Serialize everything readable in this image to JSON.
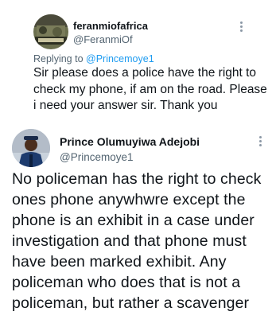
{
  "reply_tweet": {
    "display_name": "feranmiofafrica",
    "handle": "@FeranmiOf",
    "replying_to_prefix": "Replying to ",
    "replying_to_mention": "@Princemoye1",
    "body": "Sir please does a police have the right to check my phone, if am on the road. Please i need your answer sir. Thank you",
    "avatar_icon": "military-avatar-icon"
  },
  "main_tweet": {
    "display_name": "Prince Olumuyiwa Adejobi",
    "handle": "@Princemoye1",
    "body": "No policeman has the right to check ones phone anywhwre except the phone is an exhibit in a case under investigation and that phone must have been marked exhibit. Any policeman who does that is not a policeman, but rather a scavenger",
    "avatar_icon": "police-officer-avatar-icon"
  },
  "colors": {
    "text": "#0f1419",
    "muted": "#536471",
    "link": "#1d9bf0"
  }
}
